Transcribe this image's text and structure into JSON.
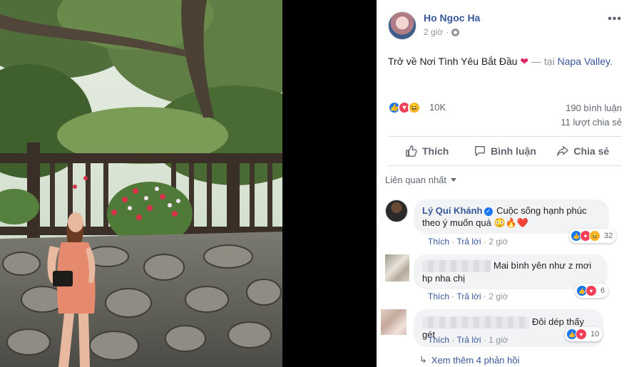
{
  "post": {
    "author": "Ho Ngoc Ha",
    "time": "2 giờ",
    "status_text": "Trở về Nơi Tình Yêu Bắt Đầu",
    "dash": "— tại",
    "place": "Napa Valley",
    "period": ".",
    "reaction_count": "10K",
    "comments_count": "190 bình luận",
    "shares_count": "11 lượt chia sẻ"
  },
  "actions": {
    "like": "Thích",
    "comment": "Bình luận",
    "share": "Chia sẻ"
  },
  "comments_sort": "Liên quan nhất",
  "comments": [
    {
      "name": "Lý Quí Khánh",
      "text_line1": "Cuộc sống hạnh phúc",
      "text_line2": "theo ý muốn quá",
      "emoji": "😳🔥❤️",
      "like": "Thích",
      "reply": "Trả lời",
      "time": "2 giờ",
      "reactions": "32"
    },
    {
      "text_line1": "Mai bình yên như z mơi",
      "text_line2": "hp nha chị",
      "like": "Thích",
      "reply": "Trả lời",
      "time": "2 giờ",
      "reactions": "6"
    },
    {
      "text_line1": "Đôi dép thấy gét",
      "like": "Thích",
      "reply": "Trả lời",
      "time": "1 giờ",
      "reactions": "10"
    }
  ],
  "more_replies": "Xem thêm 4 phản hồi",
  "colors": {
    "link": "#385898",
    "like_blue": "#1877f2",
    "love_red": "#f33e58",
    "haha_yellow": "#f7b125",
    "muted": "#90949c"
  }
}
